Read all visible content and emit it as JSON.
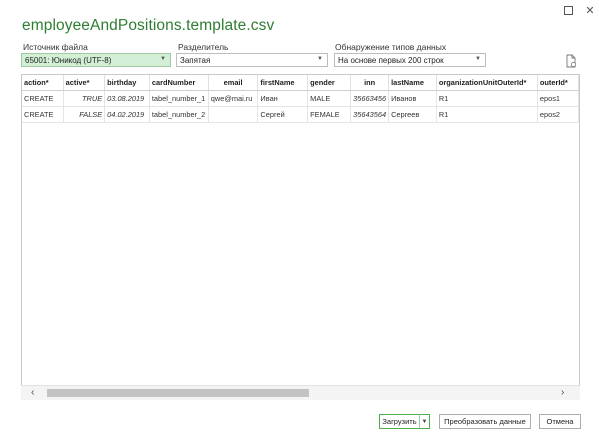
{
  "title": "employeeAndPositions.template.csv",
  "file_origin": {
    "label": "Источник файла",
    "value": "65001: Юникод (UTF-8)"
  },
  "delimiter": {
    "label": "Разделитель",
    "value": "Запятая"
  },
  "type_detection": {
    "label": "Обнаружение типов данных",
    "value": "На основе первых 200 строк"
  },
  "table": {
    "columns": [
      "action*",
      "active*",
      "birthday",
      "cardNumber",
      "email",
      "firstName",
      "gender",
      "inn",
      "lastName",
      "organizationUnitOuterId*",
      "outerId*"
    ],
    "rows": [
      [
        "CREATE",
        "TRUE",
        "03.08.2019",
        "tabel_number_1",
        "qwe@mai.ru",
        "Иван",
        "MALE",
        "35663456",
        "Иванов",
        "R1",
        "epos1"
      ],
      [
        "CREATE",
        "FALSE",
        "04.02.2019",
        "tabel_number_2",
        "",
        "Сергей",
        "FEMALE",
        "35643564",
        "Сергеев",
        "R1",
        "epos2"
      ]
    ]
  },
  "buttons": {
    "load": "Загрузить",
    "transform": "Преобразовать данные",
    "cancel": "Отмена"
  },
  "colors": {
    "accent": "#2e7d32",
    "selected_bg": "#d3f0d7"
  },
  "icons": [
    "maximize-icon",
    "close-icon",
    "refresh-icon",
    "chevron-down-icon",
    "scroll-left-icon",
    "scroll-right-icon"
  ]
}
